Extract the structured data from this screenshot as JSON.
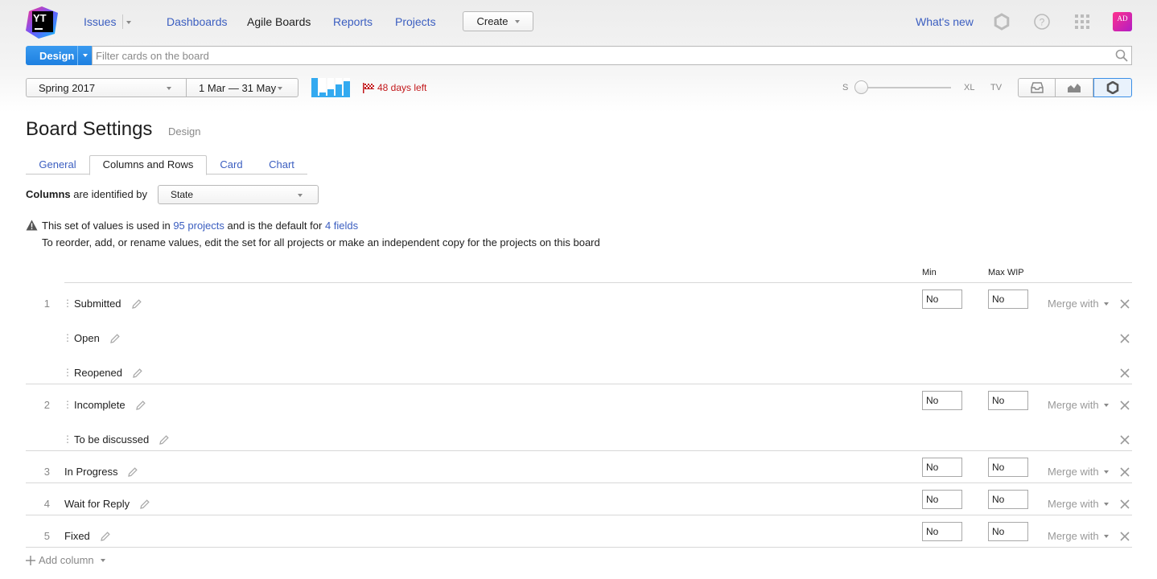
{
  "header": {
    "logo_text": "YT",
    "nav": {
      "issues": "Issues",
      "dashboards": "Dashboards",
      "agile_boards": "Agile Boards",
      "reports": "Reports",
      "projects": "Projects"
    },
    "create_label": "Create",
    "whats_new": "What's new",
    "avatar_initials": "AD"
  },
  "search": {
    "board_button": "Design",
    "placeholder": "Filter cards on the board"
  },
  "sprint": {
    "name": "Spring 2017",
    "range": "1 Mar — 31 May",
    "days_left": "48 days left"
  },
  "card_size": {
    "small": "S",
    "xlarge": "XL",
    "tv": "TV",
    "level": 0
  },
  "settings": {
    "title": "Board Settings",
    "subtitle": "Design",
    "tabs": [
      "General",
      "Columns and Rows",
      "Card",
      "Chart"
    ],
    "active_tab": "Columns and Rows",
    "columns_label_bold": "Columns",
    "columns_label_rest": " are identified by",
    "field": "State",
    "warning": {
      "prefix": "This set of values is used in ",
      "projects_link": "95 projects",
      "middle": " and is the default for ",
      "fields_link": "4 fields",
      "line2": "To reorder, add, or rename values, edit the set for all projects or make an independent copy for the projects on this board"
    },
    "headers": {
      "min": "Min",
      "max_wip": "Max WIP"
    },
    "merge_label": "Merge with",
    "rows": [
      {
        "num": "1",
        "name": "Submitted",
        "min": "No",
        "max": "No"
      },
      {
        "num": "",
        "name": "Open"
      },
      {
        "num": "",
        "name": "Reopened"
      },
      {
        "num": "2",
        "name": "Incomplete",
        "min": "No",
        "max": "No"
      },
      {
        "num": "",
        "name": "To be discussed"
      },
      {
        "num": "3",
        "name": "In Progress",
        "min": "No",
        "max": "No"
      },
      {
        "num": "4",
        "name": "Wait for Reply",
        "min": "No",
        "max": "No"
      },
      {
        "num": "5",
        "name": "Fixed",
        "min": "No",
        "max": "No"
      }
    ],
    "add_column": "Add column"
  },
  "colors": {
    "link": "#3b5ec0",
    "primary_button": "#1d7fe0",
    "warning_red": "#c2181b",
    "accent_blue": "#3a8ee6"
  }
}
